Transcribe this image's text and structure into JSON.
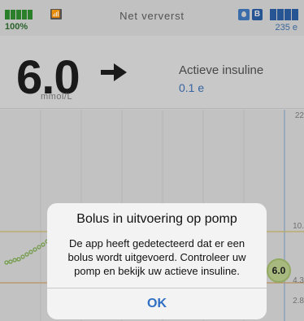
{
  "status": {
    "battery_percent": "100%",
    "signal_icon": "pump-signal-icon",
    "refresh_text": "Net ververst",
    "reservoir_units": "235 e",
    "b_label": "B"
  },
  "glucose": {
    "value": "6.0",
    "unit": "mmol/L",
    "trend_icon": "arrow-right-icon"
  },
  "active_insulin": {
    "label": "Actieve insuline",
    "value": "0.1 e"
  },
  "chart": {
    "y_ticks": [
      "22",
      "10.",
      "4.3",
      "2.8"
    ],
    "current_bubble": "6.0"
  },
  "alert": {
    "title": "Bolus in uitvoering op pomp",
    "message": "De app heeft gedetecteerd dat er een bolus wordt uitgevoerd. Controleer uw pomp en bekijk uw actieve insuline.",
    "ok_label": "OK"
  },
  "colors": {
    "accent_blue": "#2f6fc4",
    "battery_green": "#2f8a2f",
    "glucose_green": "#9fb86a"
  }
}
